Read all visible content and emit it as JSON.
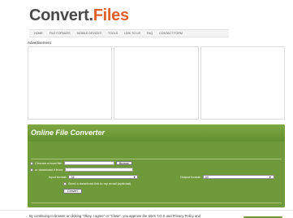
{
  "logo": {
    "part1": "Convert.",
    "part2": "Files"
  },
  "nav": [
    "HOME",
    "FILE FORMATS",
    "MOBILE DEVICES",
    "TOOLS",
    "LINK TO US",
    "FAQ",
    "CONTACT FORM"
  ],
  "ad_label": "Advertisement",
  "converter": {
    "title": "Online File Converter",
    "choose_local_label": "Choose a local file:",
    "browse_label": "Browse",
    "download_label": "or download it from:",
    "input_format_label": "Input format:",
    "input_format_value": "All",
    "output_format_label": "Output format:",
    "output_format_value": "All",
    "send_link_label": "Send a download link to my email (optional)",
    "convert_label": "Convert"
  },
  "cookie": {
    "text": "By continuing to browse or clicking \"Okay, I agree\" or \"Close\", you approve the site's T.O.S and Privacy Policy and"
  },
  "colors": {
    "accent": "#6f9a3a",
    "logo_orange": "#e2602a",
    "logo_grey": "#4a4a4a"
  }
}
